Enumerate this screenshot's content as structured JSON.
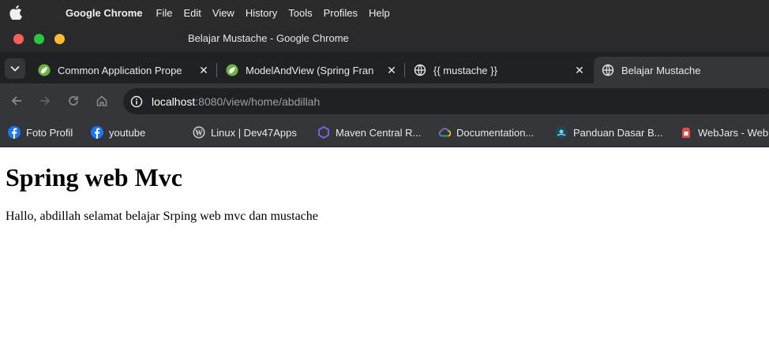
{
  "menubar": {
    "app_name": "Google Chrome",
    "items": [
      "File",
      "Edit",
      "View",
      "History",
      "Tools",
      "Profiles",
      "Help"
    ]
  },
  "window": {
    "title": "Belajar Mustache - Google Chrome"
  },
  "tabs": [
    {
      "label": "Common Application Prope",
      "icon": "spring-leaf-icon",
      "active": false
    },
    {
      "label": "ModelAndView (Spring Fran",
      "icon": "spring-leaf-icon",
      "active": false
    },
    {
      "label": "{{ mustache }}",
      "icon": "globe-icon",
      "active": false
    },
    {
      "label": "Belajar Mustache",
      "icon": "globe-icon",
      "active": true
    }
  ],
  "omnibox": {
    "host": "localhost",
    "rest": ":8080/view/home/abdillah"
  },
  "bookmarks": [
    {
      "label": "Foto Profil",
      "icon": "facebook-icon"
    },
    {
      "label": "youtube",
      "icon": "facebook-icon"
    },
    {
      "label": "Linux | Dev47Apps",
      "icon": "wordpress-icon"
    },
    {
      "label": "Maven Central R...",
      "icon": "maven-hexagon-icon"
    },
    {
      "label": "Documentation...",
      "icon": "google-cloud-icon"
    },
    {
      "label": "Panduan Dasar B...",
      "icon": "site-logo-icon"
    },
    {
      "label": "WebJars - Web",
      "icon": "webjars-icon"
    }
  ],
  "page": {
    "heading": "Spring web Mvc",
    "body": "Hallo, abdillah selamat belajar Srping web mvc dan mustache"
  },
  "colors": {
    "traffic_red": "#ff5f57",
    "traffic_green": "#28c840",
    "traffic_yellow": "#febc2e",
    "chrome_dark": "#202124",
    "chrome_toolbar": "#35363a"
  }
}
